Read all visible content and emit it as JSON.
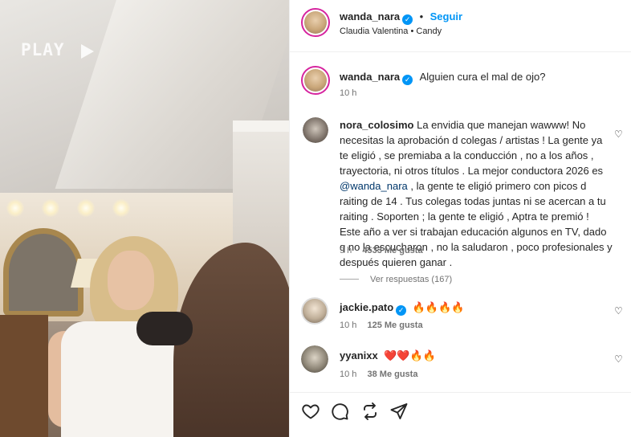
{
  "media": {
    "play_label": "PLAY"
  },
  "header": {
    "username": "wanda_nara",
    "follow_label": "Seguir",
    "subtitle": "Claudia Valentina • Candy",
    "dot": "•"
  },
  "caption": {
    "username": "wanda_nara",
    "text": "Alguien cura el mal de ojo?",
    "time": "10 h"
  },
  "comments": [
    {
      "username": "nora_colosimo",
      "text_before": "La envidia que manejan wawww! No necesitas la aprobación d colegas / artistas ! La gente ya te eligió , se premiaba a la conducción , no a los años , trayectoria, ni otros títulos . La mejor conductora 2026 es ",
      "mention": "@wanda_nara",
      "text_after": " , la gente te eligió primero con picos d raiting de 14 . Tus colegas todas juntas ni se acercan a tu raiting . Soporten ; la gente te eligió , Aptra te premió ! Este año a ver si trabajan educación algunos en TV, dado q no la escucharon , no la saludaron , poco profesionales y después quieren ganar .",
      "time": "9 h",
      "likes": "4533 Me gusta",
      "replies": "Ver respuestas (167)"
    },
    {
      "username": "jackie.pato",
      "text": "🔥🔥🔥🔥",
      "time": "10 h",
      "likes": "125 Me gusta"
    },
    {
      "username": "yyanixx",
      "text": "❤️❤️🔥🔥",
      "time": "10 h",
      "likes": "38 Me gusta"
    }
  ],
  "colors": {
    "link_blue": "#0095f6",
    "mention_blue": "#00376b",
    "text": "#262626",
    "muted": "#737373"
  },
  "icons": [
    "heart-icon",
    "comment-icon",
    "repost-icon",
    "share-icon",
    "verified-icon"
  ]
}
